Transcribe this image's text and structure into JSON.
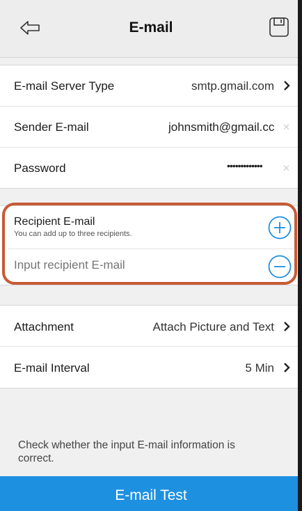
{
  "header": {
    "title": "E-mail"
  },
  "server_row": {
    "label": "E-mail Server Type",
    "value": "smtp.gmail.com"
  },
  "sender_row": {
    "label": "Sender E-mail",
    "value": "johnsmith@gmail.cc"
  },
  "password_row": {
    "label": "Password",
    "value": "•••••••••••••"
  },
  "recipient": {
    "title": "Recipient E-mail",
    "subtitle": "You can add up to three recipients.",
    "placeholder": "Input recipient E-mail",
    "value": ""
  },
  "attachment_row": {
    "label": "Attachment",
    "value": "Attach Picture and Text"
  },
  "interval_row": {
    "label": "E-mail Interval",
    "value": "5 Min"
  },
  "hint": "Check whether the input E-mail information is correct.",
  "test_button": "E-mail Test",
  "colors": {
    "accent": "#1e90e0",
    "highlight": "#c65a35"
  },
  "icons": {
    "back": "back-arrow-icon",
    "save": "save-icon",
    "chevron": "chevron-right-icon",
    "clear": "clear-icon",
    "add": "add-circle-icon",
    "remove": "remove-circle-icon"
  }
}
